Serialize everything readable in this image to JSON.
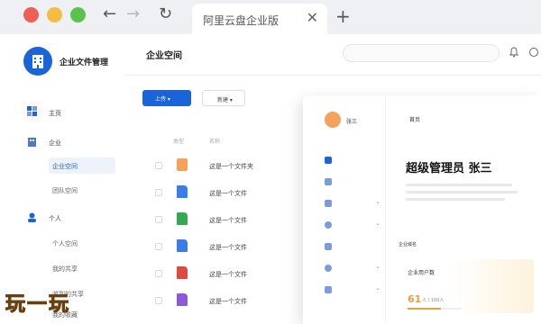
{
  "browser": {
    "tab_title": "阿里云盘企业版",
    "back_glyph": "←",
    "forward_glyph": "→",
    "reload_glyph": "↻",
    "close_glyph": "✕",
    "new_tab_glyph": "+"
  },
  "app": {
    "name": "企业文件管理"
  },
  "sidebar": {
    "home": "主页",
    "enterprise": "企业",
    "enterprise_space": "企业空间",
    "team_space": "团队空间",
    "personal": "个人",
    "personal_space": "个人空间",
    "my_shares": "我的共享",
    "received_shares": "收到的共享",
    "my_favorites": "我的收藏"
  },
  "main": {
    "title": "企业空间",
    "upload_label": "上传",
    "new_label": "新建",
    "columns": {
      "type": "类型",
      "name": "名称"
    },
    "files": [
      {
        "name": "这是一个文件夹",
        "type": "folder",
        "color": "#f5a25d"
      },
      {
        "name": "这是一个文件",
        "type": "doc",
        "color": "#3b7de6"
      },
      {
        "name": "这是一个文件",
        "type": "xls",
        "color": "#35a853"
      },
      {
        "name": "这是一个文件",
        "type": "doc",
        "color": "#3b7de6"
      },
      {
        "name": "这是一个文件",
        "type": "ppt",
        "color": "#e0493f"
      },
      {
        "name": "这是一个文件",
        "type": "other",
        "color": "#8c5ad8"
      }
    ]
  },
  "admin": {
    "user": "张三",
    "tab": "首页",
    "greeting": "超级管理员 张三",
    "enterprise_label": "企业域名",
    "usage_title": "企业用户数",
    "usage_value": "61",
    "usage_total": "人 / 100人",
    "usage_ratio": 0.61
  },
  "colors": {
    "primary": "#1b64d8",
    "accent": "#e6a23c"
  },
  "watermark": "玩一玩"
}
